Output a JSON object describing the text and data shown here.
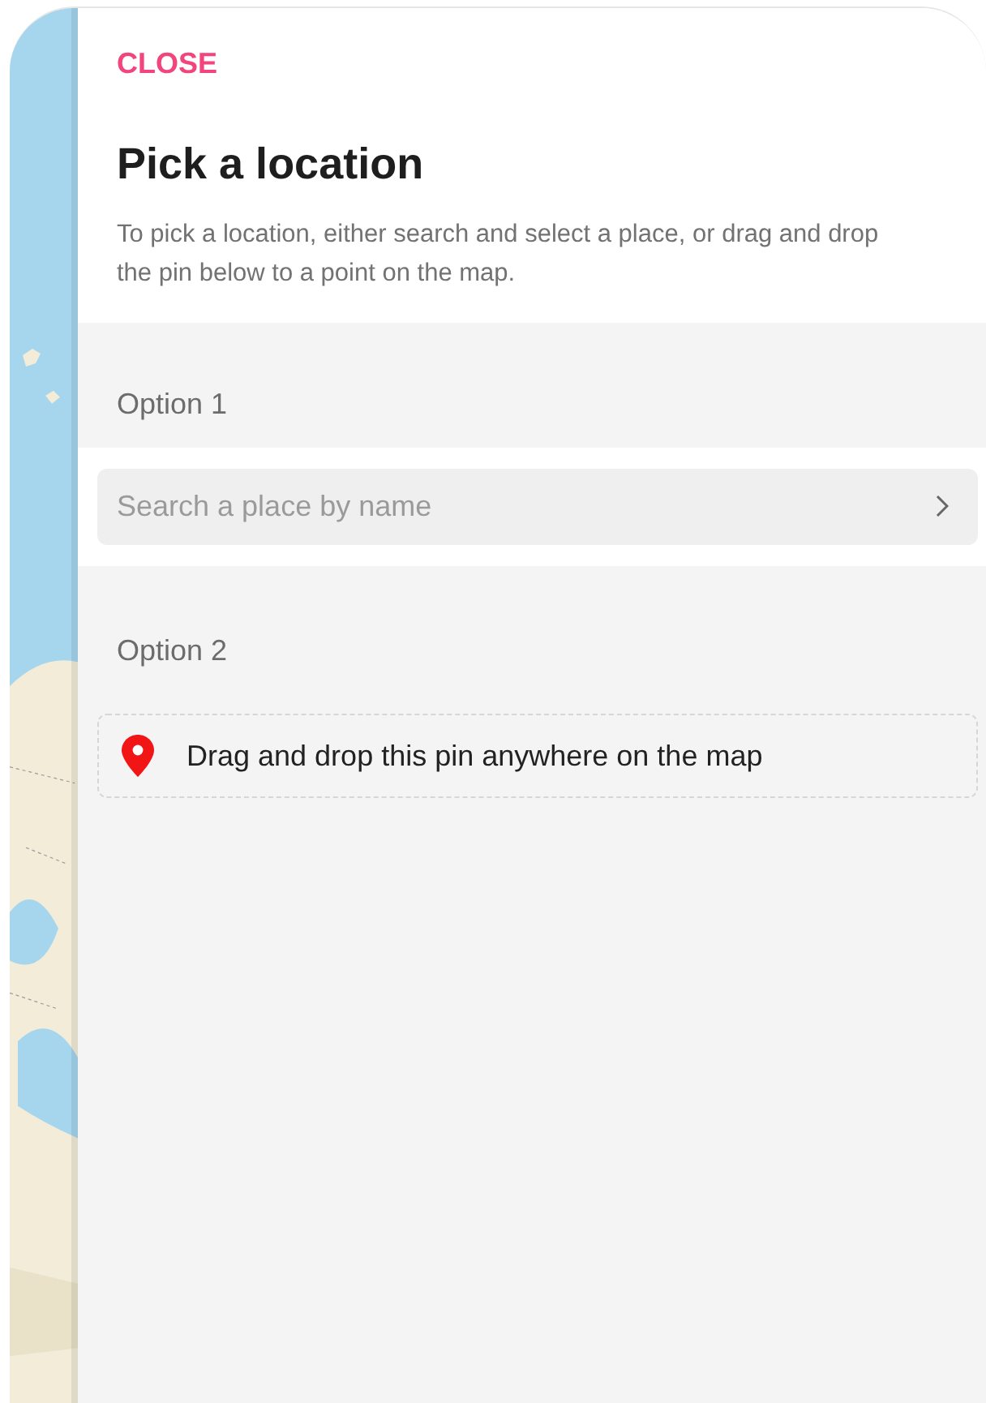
{
  "panel": {
    "close_label": "CLOSE",
    "title": "Pick a location",
    "description": "To pick a location, either search and select a place, or drag and drop the pin below to a point on the map."
  },
  "options": [
    {
      "kind": "search",
      "label": "Option 1",
      "placeholder": "Search a place by name"
    },
    {
      "kind": "pin",
      "label": "Option 2",
      "text": "Drag and drop this pin anywhere on the map"
    }
  ]
}
